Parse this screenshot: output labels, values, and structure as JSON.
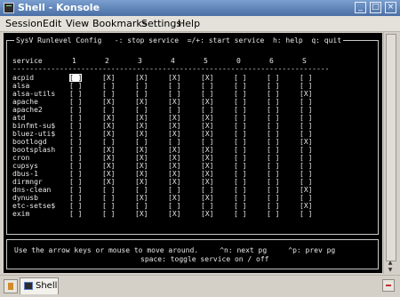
{
  "window": {
    "title": "Shell - Konsole"
  },
  "menu": [
    "Session",
    "Edit",
    "View",
    "Bookmarks",
    "Settings",
    "Help"
  ],
  "frame_title": "SysV Runlevel Config   -: stop service  =/+: start service  h: help  q: quit",
  "header": {
    "service": "service",
    "levels": [
      "1",
      "2",
      "3",
      "4",
      "5",
      "0",
      "6",
      "S"
    ]
  },
  "dashes": "----------------------------------------------------------------------------------------",
  "services": [
    {
      "name": "acpid",
      "states": [
        "[ ]",
        "[X]",
        "[X]",
        "[X]",
        "[X]",
        "[ ]",
        "[ ]",
        "[ ]"
      ]
    },
    {
      "name": "alsa",
      "states": [
        "[ ]",
        "[ ]",
        "[ ]",
        "[ ]",
        "[ ]",
        "[ ]",
        "[ ]",
        "[ ]"
      ]
    },
    {
      "name": "alsa-utils",
      "states": [
        "[ ]",
        "[ ]",
        "[ ]",
        "[ ]",
        "[ ]",
        "[ ]",
        "[ ]",
        "[X]"
      ]
    },
    {
      "name": "apache",
      "states": [
        "[ ]",
        "[X]",
        "[X]",
        "[X]",
        "[X]",
        "[ ]",
        "[ ]",
        "[ ]"
      ]
    },
    {
      "name": "apache2",
      "states": [
        "[ ]",
        "[ ]",
        "[ ]",
        "[ ]",
        "[ ]",
        "[ ]",
        "[ ]",
        "[ ]"
      ]
    },
    {
      "name": "atd",
      "states": [
        "[ ]",
        "[X]",
        "[X]",
        "[X]",
        "[X]",
        "[ ]",
        "[ ]",
        "[ ]"
      ]
    },
    {
      "name": "binfmt-su$",
      "states": [
        "[ ]",
        "[X]",
        "[X]",
        "[X]",
        "[X]",
        "[ ]",
        "[ ]",
        "[ ]"
      ]
    },
    {
      "name": "bluez-uti$",
      "states": [
        "[ ]",
        "[X]",
        "[X]",
        "[X]",
        "[X]",
        "[ ]",
        "[ ]",
        "[ ]"
      ]
    },
    {
      "name": "bootlogd",
      "states": [
        "[ ]",
        "[ ]",
        "[ ]",
        "[ ]",
        "[ ]",
        "[ ]",
        "[ ]",
        "[X]"
      ]
    },
    {
      "name": "bootsplash",
      "states": [
        "[ ]",
        "[X]",
        "[X]",
        "[X]",
        "[X]",
        "[ ]",
        "[ ]",
        "[ ]"
      ]
    },
    {
      "name": "cron",
      "states": [
        "[ ]",
        "[X]",
        "[X]",
        "[X]",
        "[X]",
        "[ ]",
        "[ ]",
        "[ ]"
      ]
    },
    {
      "name": "cupsys",
      "states": [
        "[ ]",
        "[X]",
        "[X]",
        "[X]",
        "[X]",
        "[ ]",
        "[ ]",
        "[ ]"
      ]
    },
    {
      "name": "dbus-1",
      "states": [
        "[ ]",
        "[X]",
        "[X]",
        "[X]",
        "[X]",
        "[ ]",
        "[ ]",
        "[ ]"
      ]
    },
    {
      "name": "dirmngr",
      "states": [
        "[ ]",
        "[X]",
        "[X]",
        "[X]",
        "[X]",
        "[ ]",
        "[ ]",
        "[ ]"
      ]
    },
    {
      "name": "dns-clean",
      "states": [
        "[ ]",
        "[ ]",
        "[ ]",
        "[ ]",
        "[ ]",
        "[ ]",
        "[ ]",
        "[X]"
      ]
    },
    {
      "name": "dynusb",
      "states": [
        "[ ]",
        "[ ]",
        "[X]",
        "[X]",
        "[X]",
        "[ ]",
        "[ ]",
        "[ ]"
      ]
    },
    {
      "name": "etc-setse$",
      "states": [
        "[ ]",
        "[ ]",
        "[ ]",
        "[ ]",
        "[ ]",
        "[ ]",
        "[ ]",
        "[X]"
      ]
    },
    {
      "name": "exim",
      "states": [
        "[ ]",
        "[ ]",
        "[X]",
        "[X]",
        "[X]",
        "[ ]",
        "[ ]",
        "[ ]"
      ]
    }
  ],
  "help": {
    "line1": "Use the arrow keys or mouse to move around.     ^n: next pg     ^p: prev pg",
    "line2": "space: toggle service on / off"
  },
  "tab": {
    "label": "Shell"
  },
  "colors": {
    "titlebar": "#4a6fa5",
    "terminal_bg": "#000000",
    "terminal_fg": "#e8e8e8"
  }
}
